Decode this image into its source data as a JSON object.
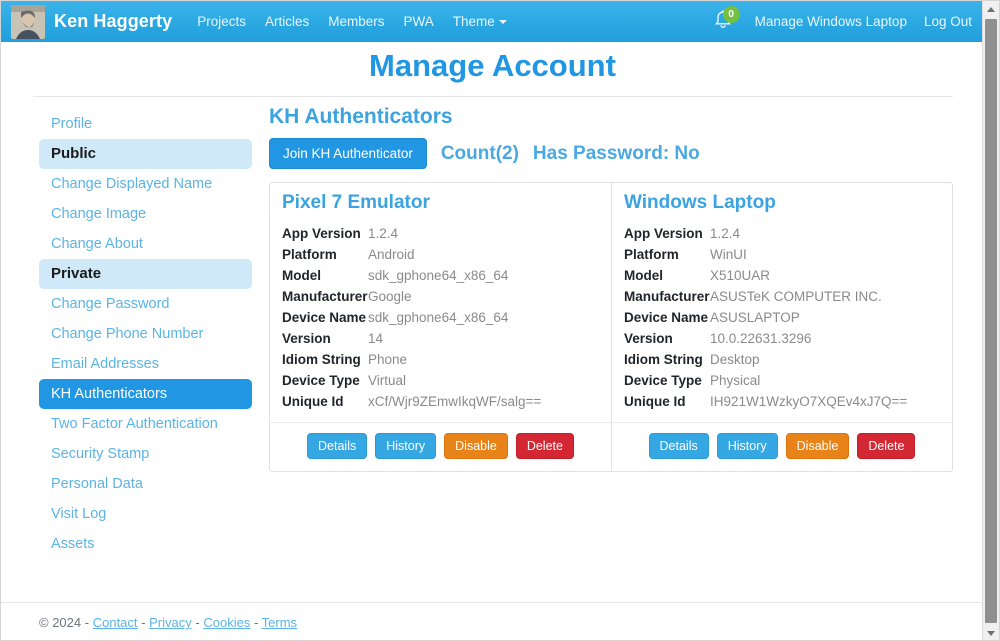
{
  "navbar": {
    "avatar_alt": "user-avatar",
    "brand_name": "Ken Haggerty",
    "links": [
      {
        "label": "Projects"
      },
      {
        "label": "Articles"
      },
      {
        "label": "Members"
      },
      {
        "label": "PWA"
      },
      {
        "label": "Theme"
      }
    ],
    "notification_count": "0",
    "manage_link": "Manage Windows Laptop",
    "logout_link": "Log Out"
  },
  "page": {
    "title": "Manage Account"
  },
  "sidebar": {
    "items": [
      {
        "label": "Profile",
        "type": "link",
        "active": false
      },
      {
        "label": "Public",
        "type": "heading",
        "active": false
      },
      {
        "label": "Change Displayed Name",
        "type": "link",
        "active": false
      },
      {
        "label": "Change Image",
        "type": "link",
        "active": false
      },
      {
        "label": "Change About",
        "type": "link",
        "active": false
      },
      {
        "label": "Private",
        "type": "heading",
        "active": false
      },
      {
        "label": "Change Password",
        "type": "link",
        "active": false
      },
      {
        "label": "Change Phone Number",
        "type": "link",
        "active": false
      },
      {
        "label": "Email Addresses",
        "type": "link",
        "active": false
      },
      {
        "label": "KH Authenticators",
        "type": "link",
        "active": true
      },
      {
        "label": "Two Factor Authentication",
        "type": "link",
        "active": false
      },
      {
        "label": "Security Stamp",
        "type": "link",
        "active": false
      },
      {
        "label": "Personal Data",
        "type": "link",
        "active": false
      },
      {
        "label": "Visit Log",
        "type": "link",
        "active": false
      },
      {
        "label": "Assets",
        "type": "link",
        "active": false
      }
    ]
  },
  "main": {
    "section_title": "KH Authenticators",
    "join_button": "Join KH Authenticator",
    "count_text": "Count(2)",
    "has_password_text": "Has Password: No",
    "cards": [
      {
        "title": "Pixel 7 Emulator",
        "rows": [
          {
            "label": "App Version",
            "value": "1.2.4"
          },
          {
            "label": "Platform",
            "value": "Android"
          },
          {
            "label": "Model",
            "value": "sdk_gphone64_x86_64"
          },
          {
            "label": "Manufacturer",
            "value": "Google"
          },
          {
            "label": "Device Name",
            "value": "sdk_gphone64_x86_64"
          },
          {
            "label": "Version",
            "value": "14"
          },
          {
            "label": "Idiom String",
            "value": "Phone"
          },
          {
            "label": "Device Type",
            "value": "Virtual"
          },
          {
            "label": "Unique Id",
            "value": "xCf/Wjr9ZEmwIkqWF/salg=="
          }
        ],
        "actions": [
          {
            "label": "Details",
            "style": "blue"
          },
          {
            "label": "History",
            "style": "blue"
          },
          {
            "label": "Disable",
            "style": "orange"
          },
          {
            "label": "Delete",
            "style": "red"
          }
        ]
      },
      {
        "title": "Windows Laptop",
        "rows": [
          {
            "label": "App Version",
            "value": "1.2.4"
          },
          {
            "label": "Platform",
            "value": "WinUI"
          },
          {
            "label": "Model",
            "value": "X510UAR"
          },
          {
            "label": "Manufacturer",
            "value": "ASUSTeK COMPUTER INC."
          },
          {
            "label": "Device Name",
            "value": "ASUSLAPTOP"
          },
          {
            "label": "Version",
            "value": "10.0.22631.3296"
          },
          {
            "label": "Idiom String",
            "value": "Desktop"
          },
          {
            "label": "Device Type",
            "value": "Physical"
          },
          {
            "label": "Unique Id",
            "value": "IH921W1WzkyO7XQEv4xJ7Q=="
          }
        ],
        "actions": [
          {
            "label": "Details",
            "style": "blue"
          },
          {
            "label": "History",
            "style": "blue"
          },
          {
            "label": "Disable",
            "style": "orange"
          },
          {
            "label": "Delete",
            "style": "red"
          }
        ]
      }
    ]
  },
  "footer": {
    "copyright": "© 2024",
    "links": [
      {
        "label": "Contact"
      },
      {
        "label": "Privacy"
      },
      {
        "label": "Cookies"
      },
      {
        "label": "Terms"
      }
    ],
    "separator": "-"
  },
  "colors": {
    "navbar": "#2aa8e2",
    "accent": "#2196e3",
    "title": "#3aa3e0",
    "badge_green": "#74c043",
    "orange": "#e8831a",
    "red": "#d32734"
  }
}
